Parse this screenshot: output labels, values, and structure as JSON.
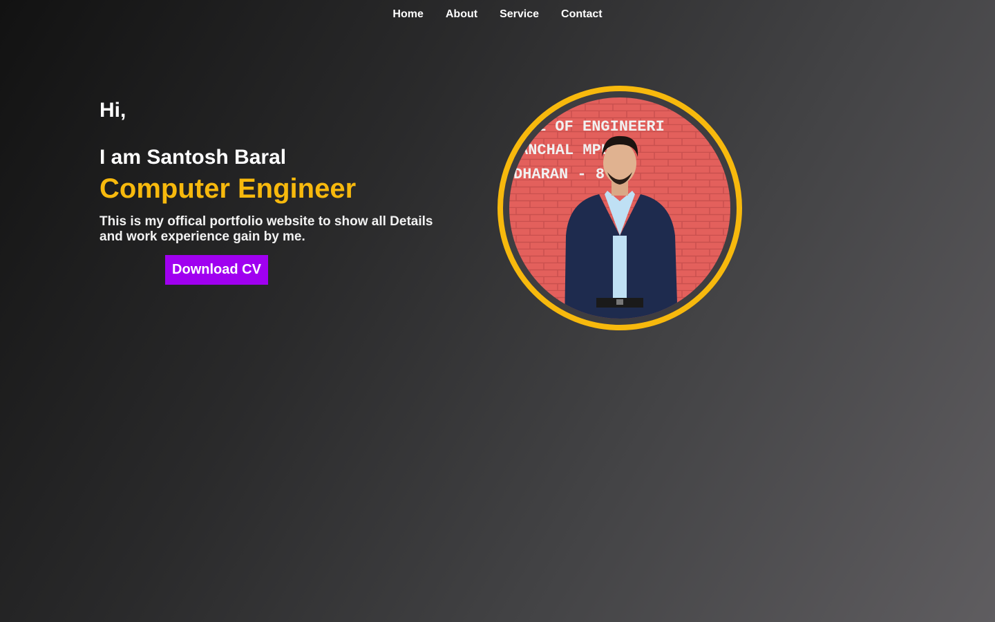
{
  "nav": {
    "items": [
      {
        "label": "Home"
      },
      {
        "label": "About"
      },
      {
        "label": "Service"
      },
      {
        "label": "Contact"
      }
    ]
  },
  "hero": {
    "greeting": "Hi,",
    "name_line": "I am Santosh Baral",
    "role": "Computer Engineer",
    "description": "This is my offical portfolio website to show all Details and work experience gain by me.",
    "cv_button_label": "Download CV"
  },
  "profile_photo": {
    "wall_text": [
      "E OF ENGINEERI",
      "ANCHAL   MPUS-",
      "DHARAN  - 8"
    ]
  },
  "colors": {
    "accent": "#f7b90d",
    "button": "#a000f0",
    "wall": "#e3605c",
    "jacket": "#1e2b4e",
    "shirt": "#bfe0f4"
  }
}
